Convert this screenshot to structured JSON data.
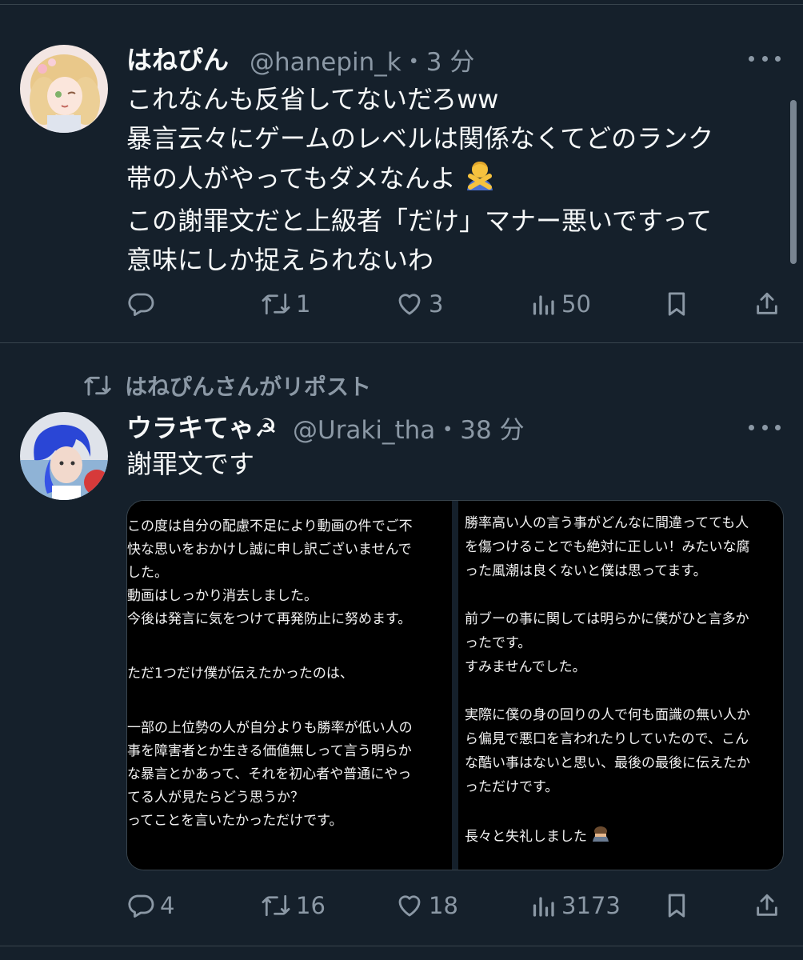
{
  "tweets": [
    {
      "display_name": "はねぴん",
      "handle": "@hanepin_k",
      "time": "・3 分",
      "text_lines": [
        "これなんも反省してないだろww",
        "暴言云々にゲームのレベルは関係なくてどのランク",
        "帯の人がやってもダメなんよ",
        "この謝罪文だと上級者「だけ」マナー悪いですって",
        "意味にしか捉えられないわ"
      ],
      "emoji_name": "person-gesturing-no-icon",
      "actions": {
        "reply": "",
        "repost": "1",
        "like": "3",
        "views": "50"
      }
    },
    {
      "repost_context": "はねぴんさんがリポスト",
      "display_name": "ウラキてゃ☭",
      "handle": "@Uraki_tha",
      "time": "・38 分",
      "text_lines": [
        "謝罪文です"
      ],
      "image_left_lines": [
        "この度は自分の配慮不足により動画の件でご不",
        "快な思いをおかけし誠に申し訳ございませんで",
        "した。",
        "動画はしっかり消去しました。",
        "今後は発言に気をつけて再発防止に努めます。",
        "",
        "ただ1つだけ僕が伝えたかったのは、",
        "",
        "一部の上位勢の人が自分よりも勝率が低い人の",
        "事を障害者とか生きる価値無しって言う明らか",
        "な暴言とかあって、それを初心者や普通にやっ",
        "てる人が見たらどう思うか？",
        "ってことを言いたかっただけです。"
      ],
      "image_right_lines": [
        "勝率高い人の言う事がどんなに間違ってても人",
        "を傷つけることでも絶対に正しい！みたいな腐",
        "った風潮は良くないと僕は思ってます。",
        "",
        "前ブーの事に関しては明らかに僕がひと言多か",
        "ったです。",
        "すみませんでした。",
        "",
        "実際に僕の身の回りの人で何も面識の無い人か",
        "ら偏見で悪口を言われたりしていたので、こん",
        "な酷い事はないと思い、最後の最後に伝えたか",
        "っただけです。",
        "",
        "長々と失礼しました"
      ],
      "image_right_emoji": "person-bowing-icon",
      "actions": {
        "reply": "4",
        "repost": "16",
        "like": "18",
        "views": "3173"
      }
    }
  ],
  "colors": {
    "background": "#15202b",
    "text": "#f7f9f9",
    "secondary": "#8b98a5",
    "divider": "#38444d"
  }
}
